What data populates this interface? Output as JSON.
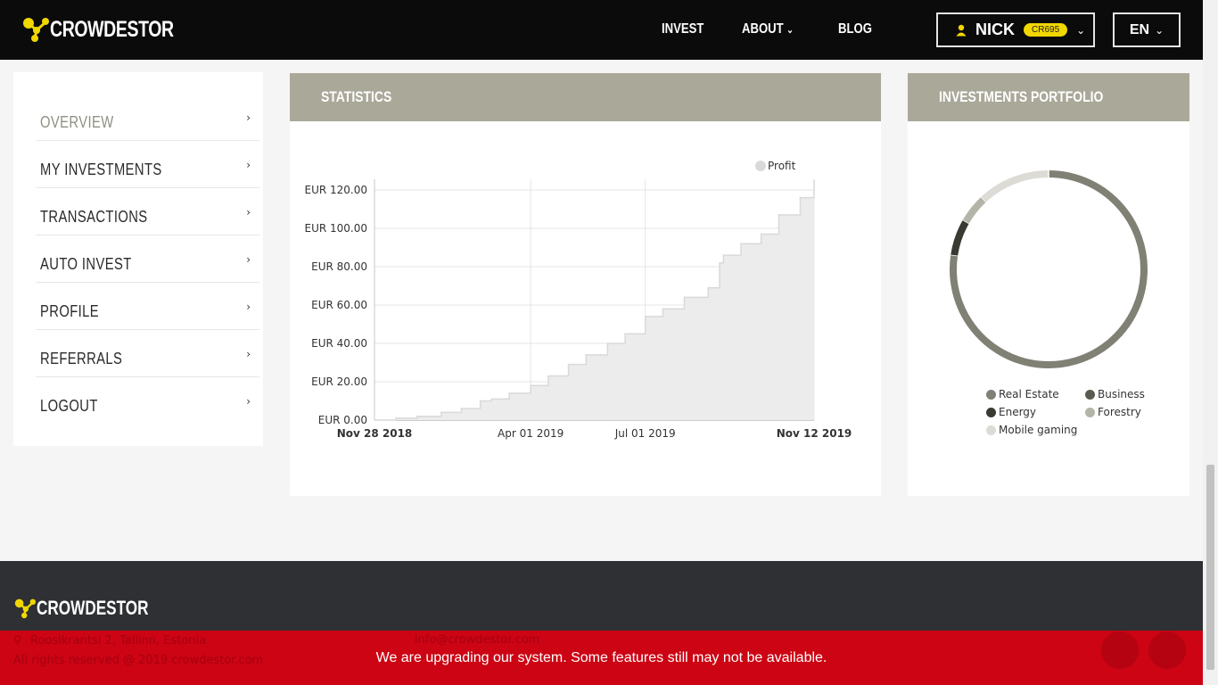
{
  "nav": {
    "brand": "CROWDESTOR",
    "links": [
      {
        "label": "INVEST"
      },
      {
        "label": "ABOUT"
      },
      {
        "label": "BLOG"
      }
    ],
    "user": {
      "name": "NICK",
      "badge": "CR695"
    },
    "language": "EN"
  },
  "sidebar": {
    "items": [
      {
        "label": "OVERVIEW",
        "active": true
      },
      {
        "label": "MY INVESTMENTS"
      },
      {
        "label": "TRANSACTIONS"
      },
      {
        "label": "AUTO INVEST"
      },
      {
        "label": "PROFILE"
      },
      {
        "label": "REFERRALS"
      },
      {
        "label": "LOGOUT"
      }
    ]
  },
  "statistics": {
    "title": "STATISTICS"
  },
  "portfolio": {
    "title": "INVESTMENTS PORTFOLIO"
  },
  "chart_data": [
    {
      "type": "area",
      "title": "",
      "xlabel": "",
      "ylabel": "",
      "legend": "top-right",
      "grid": true,
      "x_ticks": [
        "Nov 28 2018",
        "Apr 01 2019",
        "Jul 01 2019",
        "Nov 12 2019"
      ],
      "y_ticks": [
        "EUR 0.00",
        "EUR 20.00",
        "EUR 40.00",
        "EUR 60.00",
        "EUR 80.00",
        "EUR 100.00",
        "EUR 120.00"
      ],
      "ylim": [
        0,
        120
      ],
      "series": [
        {
          "name": "Profit",
          "color": "#d9d9d9",
          "fill": "#ececec",
          "x": [
            "2018-11-28",
            "2018-12-15",
            "2019-01-01",
            "2019-01-20",
            "2019-02-05",
            "2019-02-20",
            "2019-03-01",
            "2019-03-15",
            "2019-04-01",
            "2019-04-15",
            "2019-05-01",
            "2019-05-15",
            "2019-06-01",
            "2019-06-15",
            "2019-07-01",
            "2019-07-15",
            "2019-08-01",
            "2019-08-20",
            "2019-08-29",
            "2019-09-01",
            "2019-09-15",
            "2019-10-01",
            "2019-10-15",
            "2019-11-01",
            "2019-11-12"
          ],
          "values": [
            0,
            1,
            2,
            4,
            6,
            10,
            11,
            14,
            18,
            23,
            29,
            34,
            40,
            45,
            54,
            58,
            64,
            69,
            82,
            86,
            92,
            97,
            107,
            116,
            125
          ]
        }
      ]
    },
    {
      "type": "pie",
      "title": "",
      "donut": true,
      "legend": "bottom",
      "categories": [
        "Real Estate",
        "Business",
        "Energy",
        "Forestry",
        "Mobile gaming"
      ],
      "values": [
        65,
        0,
        5,
        4,
        10
      ],
      "colors": [
        "#808075",
        "#5a5a4f",
        "#3a3a33",
        "#b4b4a8",
        "#dddbd5"
      ]
    }
  ],
  "banner": {
    "message": "We are upgrading our system. Some features still may not be available."
  },
  "footer": {
    "brand": "CROWDESTOR",
    "address": "Roosikrantsi 2, Tallinn, Estonia",
    "email": "info@crowdestor.com",
    "rights": "All rights reserved @ 2019 crowdestor.com"
  }
}
